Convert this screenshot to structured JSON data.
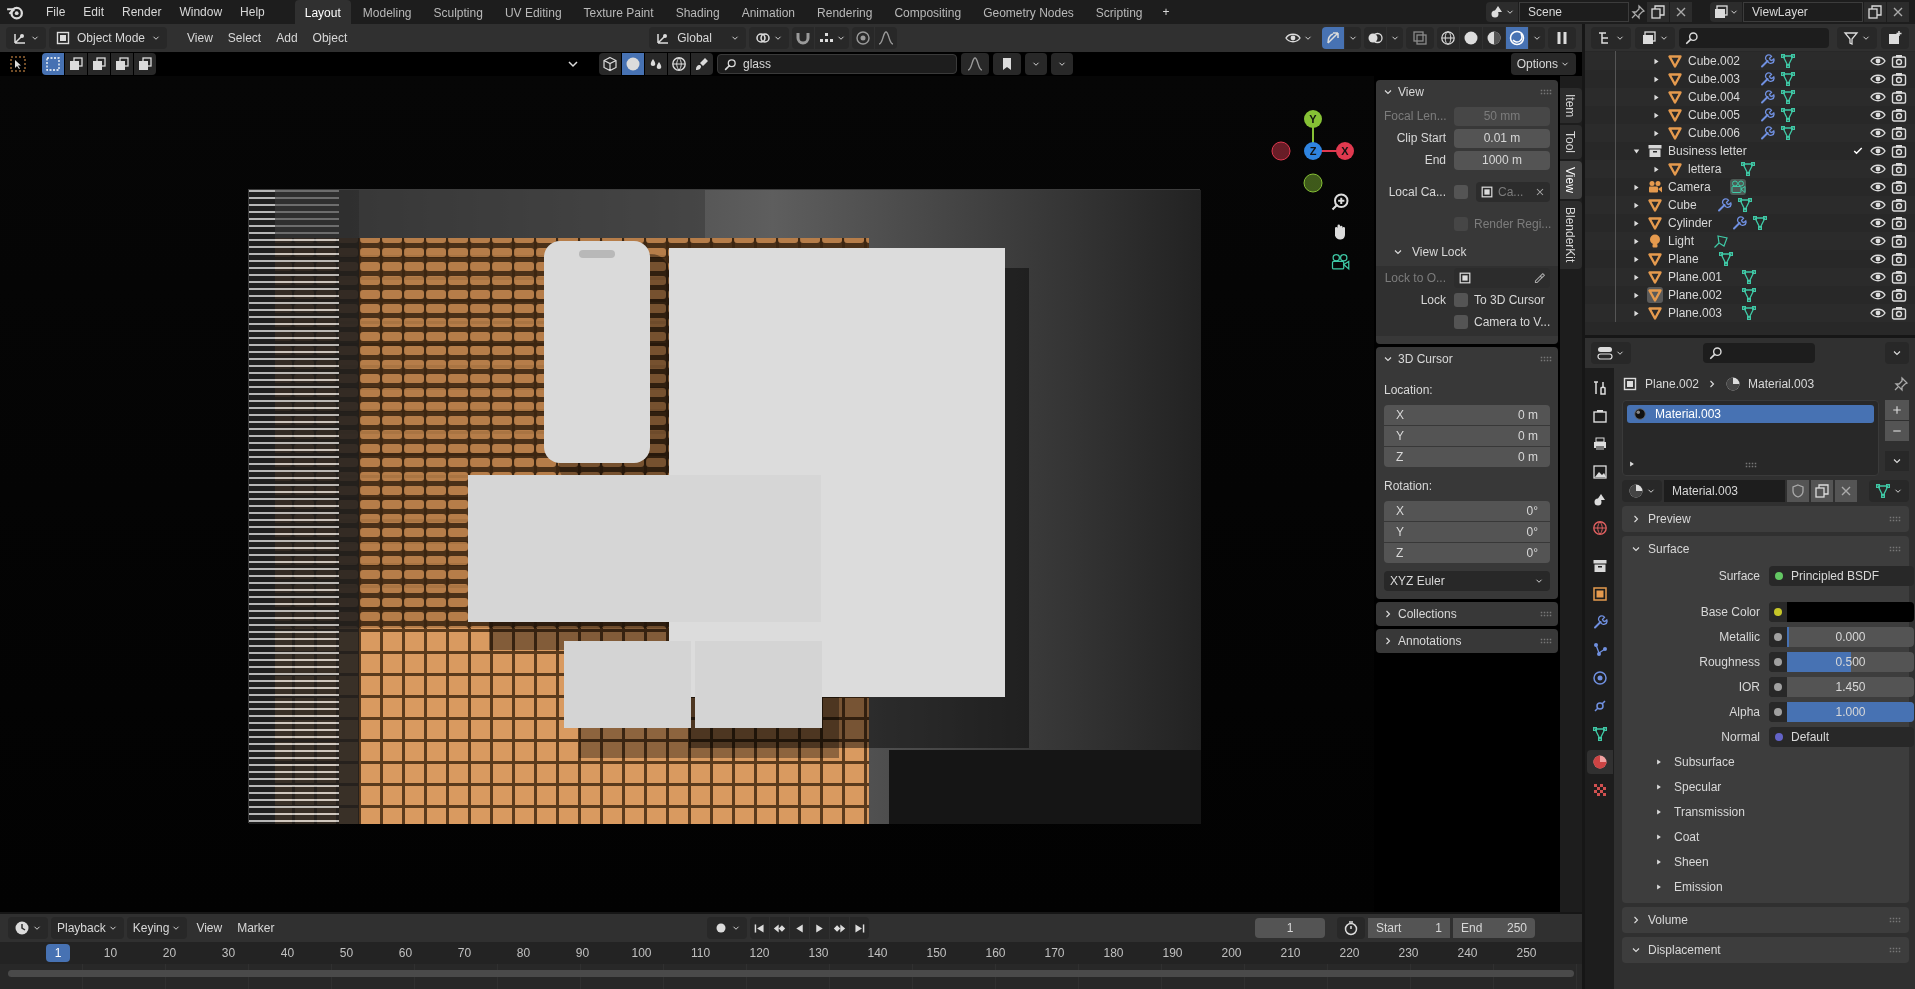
{
  "menu": [
    "File",
    "Edit",
    "Render",
    "Window",
    "Help"
  ],
  "workspaces": [
    {
      "label": "Layout",
      "selected": true
    },
    {
      "label": "Modeling",
      "selected": false
    },
    {
      "label": "Sculpting",
      "selected": false
    },
    {
      "label": "UV Editing",
      "selected": false
    },
    {
      "label": "Texture Paint",
      "selected": false
    },
    {
      "label": "Shading",
      "selected": false
    },
    {
      "label": "Animation",
      "selected": false
    },
    {
      "label": "Rendering",
      "selected": false
    },
    {
      "label": "Compositing",
      "selected": false
    },
    {
      "label": "Geometry Nodes",
      "selected": false
    },
    {
      "label": "Scripting",
      "selected": false
    }
  ],
  "add_workspace": "+",
  "scene": "Scene",
  "view_layer": "ViewLayer",
  "viewport_header": {
    "mode": "Object Mode",
    "menus": [
      "View",
      "Select",
      "Add",
      "Object"
    ],
    "orientation": "Global",
    "gizmos_on": true,
    "shading": [
      {
        "selected": false
      },
      {
        "selected": false
      },
      {
        "selected": false
      },
      {
        "selected": true
      }
    ]
  },
  "tool_header": {
    "selection_modes": [
      {
        "selected": true
      },
      {
        "selected": false
      },
      {
        "selected": false
      },
      {
        "selected": false
      },
      {
        "selected": false
      }
    ],
    "filters": [
      {
        "selected": false
      },
      {
        "selected": true
      },
      {
        "selected": false
      },
      {
        "selected": false
      },
      {
        "selected": false
      }
    ],
    "search": "glass",
    "options": "Options"
  },
  "gizmo": [
    {
      "label": "Y",
      "color": "#86c135"
    },
    {
      "label": "Z",
      "color": "#2f84e0"
    },
    {
      "label": "X",
      "color": "#e0394f"
    }
  ],
  "sidebar": {
    "tabs": [
      {
        "label": "Item",
        "selected": false
      },
      {
        "label": "Tool",
        "selected": false
      },
      {
        "label": "View",
        "selected": true
      },
      {
        "label": "BlenderKit",
        "selected": false
      }
    ],
    "panels": [
      {
        "title": "View",
        "expanded": true,
        "rows": [
          {
            "kind": "field",
            "label": "Focal Len...",
            "value": "50 mm",
            "disabled": true
          },
          {
            "kind": "field",
            "label": "Clip Start",
            "value": "0.01 m",
            "disabled": false
          },
          {
            "kind": "field",
            "label": "End",
            "value": "1000 m",
            "disabled": false
          },
          {
            "kind": "check_field",
            "label": "Local Ca...",
            "checked": false,
            "value": "Ca..."
          },
          {
            "kind": "check",
            "text": "Render Regi...",
            "checked": false,
            "disabled": true
          },
          {
            "kind": "subpanel",
            "title": "View Lock",
            "expanded": true,
            "rows": [
              {
                "kind": "object_field",
                "label": "Lock to O...",
                "disabled": true
              },
              {
                "kind": "check",
                "label": "Lock",
                "text": "To 3D Cursor",
                "checked": false,
                "disabled": false
              },
              {
                "kind": "check",
                "text": "Camera to V...",
                "checked": false,
                "disabled": false
              }
            ]
          }
        ]
      },
      {
        "title": "3D Cursor",
        "expanded": true,
        "rows": [
          {
            "kind": "vector",
            "label": "Location:",
            "items": [
              {
                "axis": "X",
                "value": "0 m"
              },
              {
                "axis": "Y",
                "value": "0 m"
              },
              {
                "axis": "Z",
                "value": "0 m"
              }
            ]
          },
          {
            "kind": "vector",
            "label": "Rotation:",
            "items": [
              {
                "axis": "X",
                "value": "0°"
              },
              {
                "axis": "Y",
                "value": "0°"
              },
              {
                "axis": "Z",
                "value": "0°"
              }
            ]
          },
          {
            "kind": "dropdown",
            "value": "XYZ Euler"
          }
        ]
      },
      {
        "title": "Collections",
        "expanded": false
      },
      {
        "title": "Annotations",
        "expanded": false
      }
    ]
  },
  "outliner": {
    "rows": [
      {
        "children": [
          {
            "name": "Cube.002",
            "kind": "mesh",
            "expanded": false,
            "selected": false,
            "badges": [
              {
                "kind": "modifier"
              },
              {
                "kind": "mesh"
              }
            ]
          },
          {
            "name": "Cube.003",
            "kind": "mesh",
            "expanded": false,
            "selected": false,
            "badges": [
              {
                "kind": "modifier"
              },
              {
                "kind": "mesh"
              }
            ]
          },
          {
            "name": "Cube.004",
            "kind": "mesh",
            "expanded": false,
            "selected": false,
            "badges": [
              {
                "kind": "modifier"
              },
              {
                "kind": "mesh"
              }
            ]
          },
          {
            "name": "Cube.005",
            "kind": "mesh",
            "expanded": false,
            "selected": false,
            "badges": [
              {
                "kind": "modifier"
              },
              {
                "kind": "mesh"
              }
            ]
          },
          {
            "name": "Cube.006",
            "kind": "mesh",
            "expanded": false,
            "selected": false,
            "badges": [
              {
                "kind": "modifier"
              },
              {
                "kind": "mesh"
              }
            ]
          }
        ]
      },
      {
        "name": "Business letter",
        "kind": "collection",
        "expanded": true,
        "selected": false,
        "checked": true,
        "children": [
          {
            "name": "lettera",
            "kind": "mesh",
            "expanded": false,
            "selected": false,
            "badges": [
              {
                "kind": "mesh"
              }
            ]
          }
        ]
      },
      {
        "name": "Camera",
        "kind": "camera",
        "expanded": false,
        "selected": false,
        "badges": [
          {
            "kind": "camera"
          }
        ]
      },
      {
        "name": "Cube",
        "kind": "mesh",
        "expanded": false,
        "selected": false,
        "badges": [
          {
            "kind": "modifier"
          },
          {
            "kind": "mesh"
          }
        ]
      },
      {
        "name": "Cylinder",
        "kind": "mesh",
        "expanded": false,
        "selected": false,
        "badges": [
          {
            "kind": "modifier"
          },
          {
            "kind": "mesh"
          }
        ]
      },
      {
        "name": "Light",
        "kind": "light",
        "expanded": false,
        "selected": false,
        "badges": [
          {
            "kind": "light"
          }
        ]
      },
      {
        "name": "Plane",
        "kind": "mesh",
        "expanded": false,
        "selected": false,
        "badges": [
          {
            "kind": "mesh"
          }
        ]
      },
      {
        "name": "Plane.001",
        "kind": "mesh",
        "expanded": false,
        "selected": false,
        "badges": [
          {
            "kind": "mesh"
          }
        ]
      },
      {
        "name": "Plane.002",
        "kind": "mesh",
        "expanded": false,
        "selected": true,
        "badges": [
          {
            "kind": "mesh"
          }
        ]
      },
      {
        "name": "Plane.003",
        "kind": "mesh",
        "expanded": false,
        "selected": false,
        "badges": [
          {
            "kind": "mesh"
          }
        ]
      }
    ]
  },
  "properties": {
    "tabs": [
      {
        "selected": false
      },
      {
        "selected": false
      },
      {
        "selected": false
      },
      {
        "selected": false
      },
      {
        "selected": false
      },
      {
        "selected": false
      },
      {
        "selected": false
      },
      {
        "selected": false
      },
      {
        "selected": false
      },
      {
        "selected": false
      },
      {
        "selected": false
      },
      {
        "selected": false
      },
      {
        "selected": false
      },
      {
        "selected": true
      },
      {
        "selected": false
      }
    ],
    "breadcrumb": [
      "Plane.002",
      "Material.003"
    ],
    "slots": [
      {
        "name": "Material.003",
        "selected": true
      }
    ],
    "material_name": "Material.003",
    "panels": [
      {
        "title": "Preview",
        "expanded": false
      },
      {
        "title": "Surface",
        "expanded": true,
        "rows": [
          {
            "kind": "link",
            "label": "Surface",
            "value": "Principled BSDF",
            "color": "#63c763"
          },
          {
            "kind": "color",
            "label": "Base Color",
            "color": "#c7c729",
            "swatch": {
              "color": "#000000"
            }
          },
          {
            "kind": "slider",
            "label": "Metallic",
            "value": "0.000",
            "level": 0,
            "color": "#a1a1a1"
          },
          {
            "kind": "slider",
            "label": "Roughness",
            "value": "0.500",
            "level": 0.5,
            "color": "#a1a1a1"
          },
          {
            "kind": "number",
            "label": "IOR",
            "value": "1.450",
            "color": "#a1a1a1"
          },
          {
            "kind": "slider",
            "label": "Alpha",
            "value": "1.000",
            "level": 1,
            "color": "#a1a1a1"
          },
          {
            "kind": "link",
            "label": "Normal",
            "value": "Default",
            "color": "#6363c7"
          },
          {
            "kind": "subpanel",
            "label": "Subsurface",
            "expanded": false
          },
          {
            "kind": "subpanel",
            "label": "Specular",
            "expanded": false
          },
          {
            "kind": "subpanel",
            "label": "Transmission",
            "expanded": false
          },
          {
            "kind": "subpanel",
            "label": "Coat",
            "expanded": false
          },
          {
            "kind": "subpanel",
            "label": "Sheen",
            "expanded": false
          },
          {
            "kind": "subpanel",
            "label": "Emission",
            "expanded": false
          }
        ]
      },
      {
        "title": "Volume",
        "expanded": false
      },
      {
        "title": "Displacement",
        "expanded": true
      }
    ]
  },
  "timeline": {
    "menus": [
      "Playback",
      "Keying",
      "View",
      "Marker"
    ],
    "current_frame": "1",
    "start_label": "Start",
    "start": "1",
    "end_label": "End",
    "end": "250",
    "ruler": [
      {
        "label": "1",
        "selected": true
      },
      {
        "label": "10",
        "selected": false
      },
      {
        "label": "20",
        "selected": false
      },
      {
        "label": "30",
        "selected": false
      },
      {
        "label": "40",
        "selected": false
      },
      {
        "label": "50",
        "selected": false
      },
      {
        "label": "60",
        "selected": false
      },
      {
        "label": "70",
        "selected": false
      },
      {
        "label": "80",
        "selected": false
      },
      {
        "label": "90",
        "selected": false
      },
      {
        "label": "100",
        "selected": false
      },
      {
        "label": "110",
        "selected": false
      },
      {
        "label": "120",
        "selected": false
      },
      {
        "label": "130",
        "selected": false
      },
      {
        "label": "140",
        "selected": false
      },
      {
        "label": "150",
        "selected": false
      },
      {
        "label": "160",
        "selected": false
      },
      {
        "label": "170",
        "selected": false
      },
      {
        "label": "180",
        "selected": false
      },
      {
        "label": "190",
        "selected": false
      },
      {
        "label": "200",
        "selected": false
      },
      {
        "label": "210",
        "selected": false
      },
      {
        "label": "220",
        "selected": false
      },
      {
        "label": "230",
        "selected": false
      },
      {
        "label": "240",
        "selected": false
      },
      {
        "label": "250",
        "selected": false
      }
    ]
  }
}
